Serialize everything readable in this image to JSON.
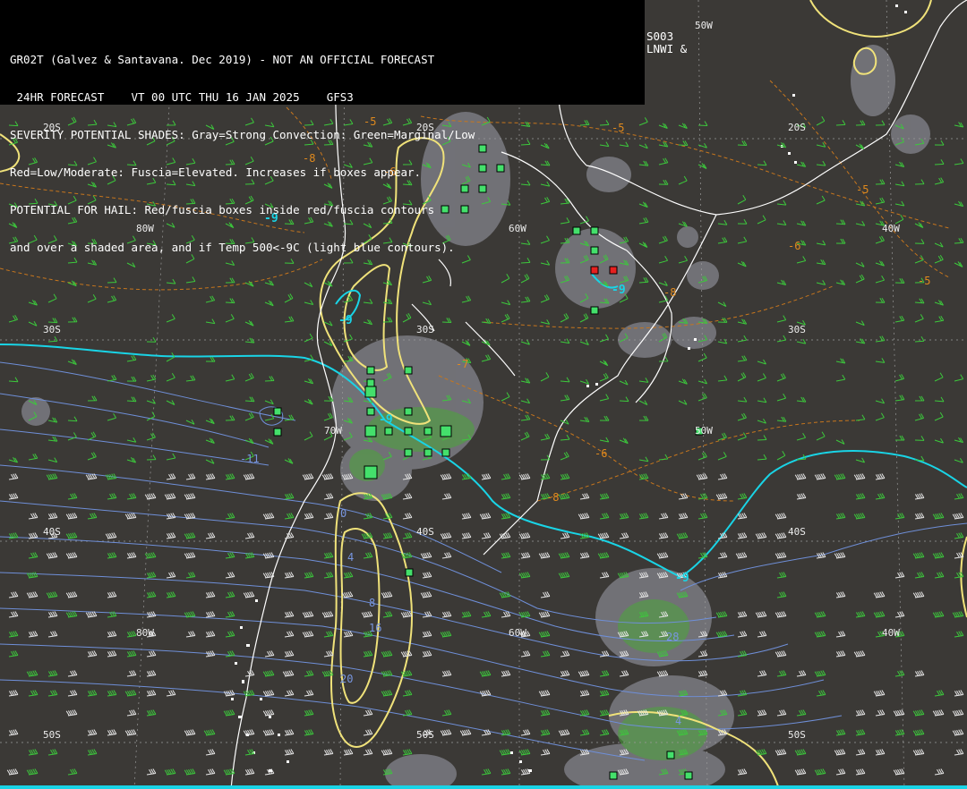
{
  "header": {
    "lines": [
      "GR02T (Galvez & Santavana. Dec 2019) - NOT AN OFFICIAL FORECAST",
      " 24HR FORECAST    VT 00 UTC THU 16 JAN 2025    GFS3",
      "SEVERITY POTENTIAL SHADES: Gray=Strong Convection: Green=Marginal/Low",
      "Red=Low/Moderate: Fuscia=Elevated. Increases if boxes appear.",
      "POTENTIAL FOR HAIL: Red/fuscia boxes inside red/fuscia contours",
      "and over a shaded area, and if Temp 500<-9C (light blue contours)."
    ],
    "right_code": "S003",
    "right_code2": "LNWI &"
  },
  "grid_labels": {
    "lat_20s": "20S",
    "lat_30s": "30S",
    "lat_40s": "40S",
    "lat_50s": "50S",
    "lon_80w": "80W",
    "lon_70w": "70W",
    "lon_60w": "60W",
    "lon_50w": "50W",
    "lon_40w": "40W"
  },
  "isotherm_labels": {
    "orange": [
      "-5",
      "-8",
      "-6",
      "-5",
      "-5",
      "-6",
      "-7",
      "-8",
      "-5",
      "-6",
      "-8",
      "-5"
    ],
    "cyan": [
      "-9",
      "-9",
      "-9",
      "-9",
      "-9"
    ],
    "blue": [
      "-11",
      "0",
      "4",
      "8",
      "16",
      "20",
      "28",
      "4",
      "16"
    ]
  },
  "legend_colors": {
    "strong_convection": "#7b7b82",
    "marginal_low": "#4aa63a",
    "low_moderate": "#d4463a",
    "elevated": "#d04ad0",
    "temp500_contour": "#19d4e6",
    "coast": "#ffffff",
    "yellow_contour": "#f0e27a",
    "orange_isotherm": "#e08a1e",
    "blue_contour": "#6f8fd8",
    "wind_barbs": "#3cc83c"
  }
}
